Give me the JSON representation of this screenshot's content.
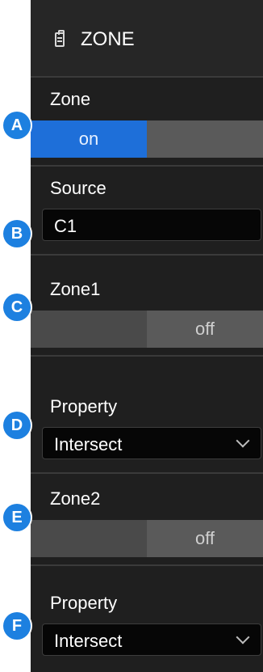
{
  "header": {
    "title": "ZONE",
    "icon": "clipboard-icon"
  },
  "zone": {
    "label": "Zone",
    "on_label": "on",
    "off_label": "",
    "state": "on"
  },
  "source": {
    "label": "Source",
    "value": "C1"
  },
  "zone1": {
    "label": "Zone1",
    "on_label": "",
    "off_label": "off",
    "state": "off"
  },
  "property1": {
    "label": "Property",
    "value": "Intersect"
  },
  "zone2": {
    "label": "Zone2",
    "on_label": "",
    "off_label": "off",
    "state": "off"
  },
  "property2": {
    "label": "Property",
    "value": "Intersect"
  },
  "markers": [
    "A",
    "B",
    "C",
    "D",
    "E",
    "F"
  ],
  "colors": {
    "accent": "#1e6fd9",
    "panel": "#1f1f1f",
    "marker": "#1d80e0"
  }
}
